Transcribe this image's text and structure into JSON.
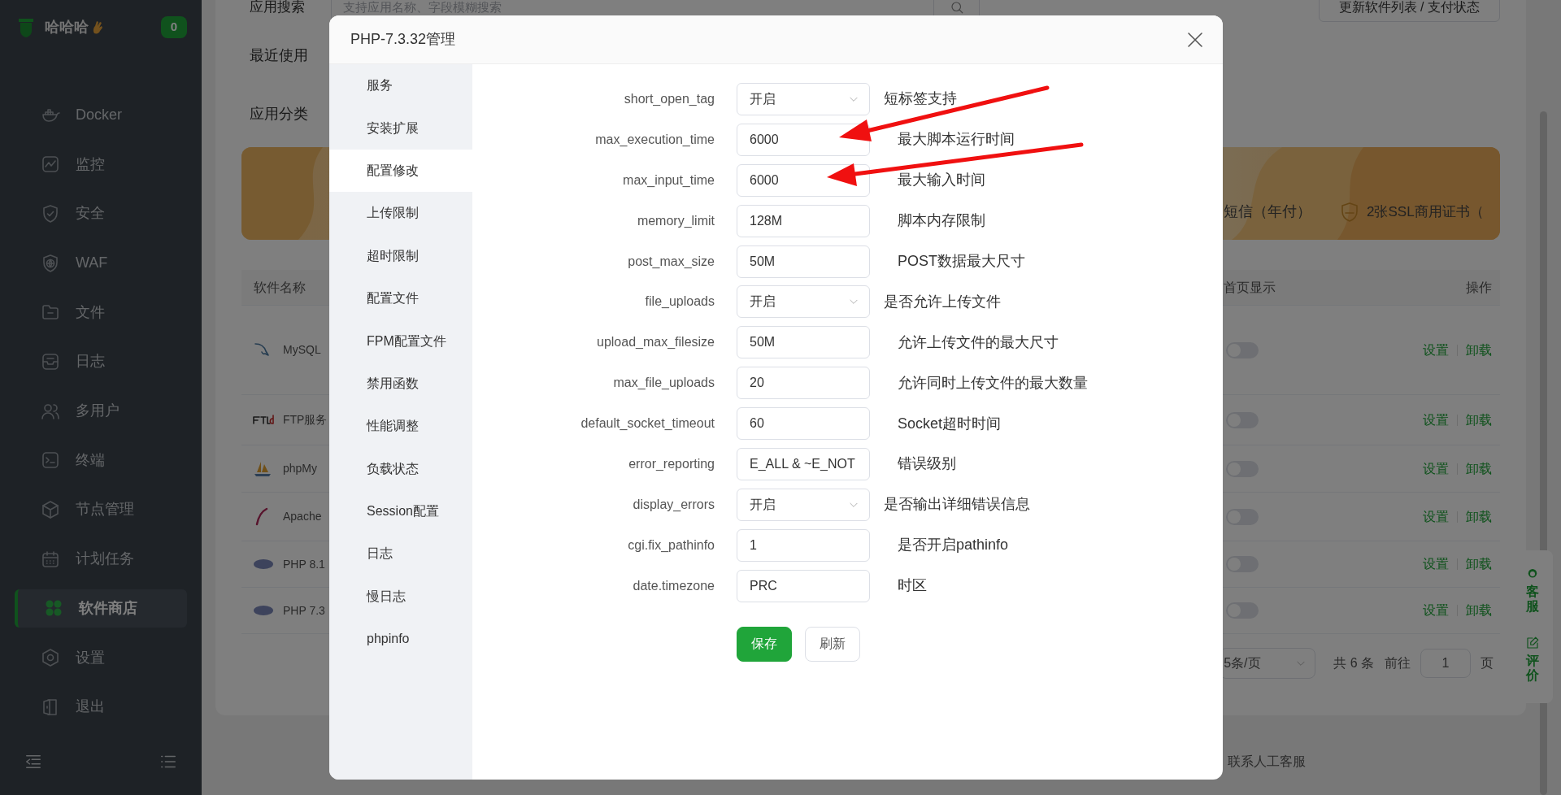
{
  "sidebar": {
    "brand": "哈哈哈",
    "badge": "0",
    "items": [
      {
        "label": "Docker",
        "selected": false
      },
      {
        "label": "监控",
        "selected": false
      },
      {
        "label": "安全",
        "selected": false
      },
      {
        "label": "WAF",
        "selected": false
      },
      {
        "label": "文件",
        "selected": false
      },
      {
        "label": "日志",
        "selected": false
      },
      {
        "label": "多用户",
        "selected": false
      },
      {
        "label": "终端",
        "selected": false
      },
      {
        "label": "节点管理",
        "selected": false
      },
      {
        "label": "计划任务",
        "selected": false
      },
      {
        "label": "软件商店",
        "selected": true
      },
      {
        "label": "设置",
        "selected": false
      },
      {
        "label": "退出",
        "selected": false
      }
    ]
  },
  "store": {
    "search_label": "应用搜索",
    "search_placeholder": "支持应用名称、字段模糊搜索",
    "update_button": "更新软件列表 / 支付状态",
    "recent_label": "最近使用",
    "category_label": "应用分类",
    "banner_items": [
      "短信（年付）",
      "2张SSL商用证书（"
    ],
    "table": {
      "columns": [
        "软件名称",
        "首页显示",
        "操作"
      ],
      "rows": [
        {
          "name": "MySQL",
          "home_display": false,
          "actions": [
            "设置",
            "卸载"
          ]
        },
        {
          "name": "FTP服务",
          "home_display": false,
          "actions": [
            "设置",
            "卸载"
          ]
        },
        {
          "name": "phpMy",
          "home_display": false,
          "actions": [
            "设置",
            "卸载"
          ]
        },
        {
          "name": "Apache",
          "home_display": false,
          "actions": [
            "设置",
            "卸载"
          ]
        },
        {
          "name": "PHP 8.1",
          "home_display": false,
          "actions": [
            "设置",
            "卸载"
          ]
        },
        {
          "name": "PHP 7.3",
          "home_display": false,
          "actions": [
            "设置",
            "卸载"
          ]
        }
      ]
    },
    "pagination": {
      "page_size": "5条/页",
      "total": "共 6 条",
      "goto_label": "前往",
      "page": "1",
      "page_suffix": "页"
    },
    "contact": "联系人工客服",
    "float_widget": [
      "客服",
      "评价"
    ]
  },
  "modal": {
    "title": "PHP-7.3.32管理",
    "menu": [
      {
        "label": "服务",
        "selected": false
      },
      {
        "label": "安装扩展",
        "selected": false
      },
      {
        "label": "配置修改",
        "selected": true
      },
      {
        "label": "上传限制",
        "selected": false
      },
      {
        "label": "超时限制",
        "selected": false
      },
      {
        "label": "配置文件",
        "selected": false
      },
      {
        "label": "FPM配置文件",
        "selected": false
      },
      {
        "label": "禁用函数",
        "selected": false
      },
      {
        "label": "性能调整",
        "selected": false
      },
      {
        "label": "负载状态",
        "selected": false
      },
      {
        "label": "Session配置",
        "selected": false
      },
      {
        "label": "日志",
        "selected": false
      },
      {
        "label": "慢日志",
        "selected": false
      },
      {
        "label": "phpinfo",
        "selected": false
      }
    ],
    "settings": [
      {
        "kind": "select",
        "key": "short_open_tag",
        "value": "开启",
        "description": "短标签支持"
      },
      {
        "kind": "input",
        "key": "max_execution_time",
        "value": "6000",
        "description": "最大脚本运行时间"
      },
      {
        "kind": "input",
        "key": "max_input_time",
        "value": "6000",
        "description": "最大输入时间"
      },
      {
        "kind": "input",
        "key": "memory_limit",
        "value": "128M",
        "description": "脚本内存限制"
      },
      {
        "kind": "input",
        "key": "post_max_size",
        "value": "50M",
        "description": "POST数据最大尺寸"
      },
      {
        "kind": "select",
        "key": "file_uploads",
        "value": "开启",
        "description": "是否允许上传文件"
      },
      {
        "kind": "input",
        "key": "upload_max_filesize",
        "value": "50M",
        "description": "允许上传文件的最大尺寸"
      },
      {
        "kind": "input",
        "key": "max_file_uploads",
        "value": "20",
        "description": "允许同时上传文件的最大数量"
      },
      {
        "kind": "input",
        "key": "default_socket_timeout",
        "value": "60",
        "description": "Socket超时时间"
      },
      {
        "kind": "input",
        "key": "error_reporting",
        "value": "E_ALL & ~E_NOT",
        "description": "错误级别"
      },
      {
        "kind": "select",
        "key": "display_errors",
        "value": "开启",
        "description": "是否输出详细错误信息"
      },
      {
        "kind": "input",
        "key": "cgi.fix_pathinfo",
        "value": "1",
        "description": "是否开启pathinfo"
      },
      {
        "kind": "input",
        "key": "date.timezone",
        "value": "PRC",
        "description": "时区"
      }
    ],
    "buttons": [
      {
        "kind": "primary",
        "label": "保存"
      },
      {
        "kind": "default",
        "label": "刷新"
      }
    ]
  }
}
